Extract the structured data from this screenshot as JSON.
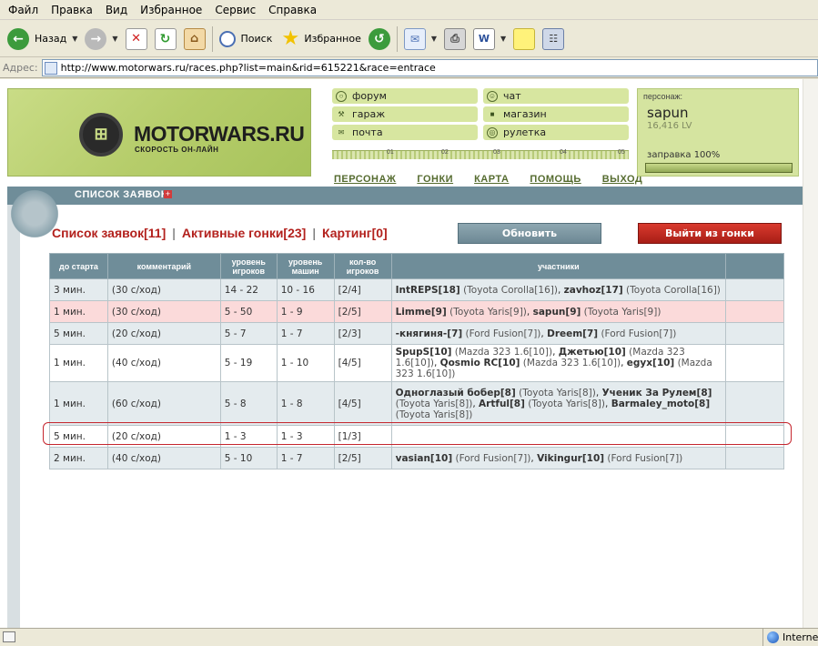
{
  "menu": [
    "Файл",
    "Правка",
    "Вид",
    "Избранное",
    "Сервис",
    "Справка"
  ],
  "toolbar": {
    "back_label": "Назад",
    "search_label": "Поиск",
    "favorites_label": "Избранное"
  },
  "address": {
    "label": "Адрес:",
    "url": "http://www.motorwars.ru/races.php?list=main&rid=615221&race=entrace"
  },
  "logo": {
    "name": "MOTORWARS.RU",
    "tagline": "СКОРОСТЬ ОН-ЛАЙН"
  },
  "nav": {
    "items": [
      {
        "label": "форум",
        "icon": "forum-icon"
      },
      {
        "label": "чат",
        "icon": "chat-icon"
      },
      {
        "label": "гараж",
        "icon": "wrench-icon"
      },
      {
        "label": "магазин",
        "icon": "car-icon"
      },
      {
        "label": "почта",
        "icon": "mail-icon"
      },
      {
        "label": "рулетка",
        "icon": "roulette-icon"
      }
    ],
    "scale": [
      "01",
      "02",
      "03",
      "04",
      "05"
    ],
    "links": [
      "ПЕРСОНАЖ",
      "ГОНКИ",
      "КАРТА",
      "ПОМОЩЬ",
      "ВЫХОД"
    ]
  },
  "player": {
    "header": "персонаж:",
    "name": "sapun",
    "level": "16,416 LV",
    "fuel_label": "заправка 100%",
    "fuel_percent": 100
  },
  "section": {
    "title": "СПИСОК ЗАЯВОК",
    "plus": "+"
  },
  "tabs": [
    {
      "label": "Список заявок[11]"
    },
    {
      "label": "Активные гонки[23]"
    },
    {
      "label": "Картинг[0]"
    }
  ],
  "buttons": {
    "refresh": "Обновить",
    "exit_race": "Выйти из гонки"
  },
  "table": {
    "headers": [
      "до старта",
      "комментарий",
      "уровень игроков",
      "уровень машин",
      "кол-во игроков",
      "участники",
      ""
    ],
    "rows": [
      {
        "start": "3 мин.",
        "comment": "(30 с/ход)",
        "player_level": "14 - 22",
        "car_level": "10 - 16",
        "count": "[2/4]",
        "style": "odd",
        "participants": [
          {
            "name": "IntREPS[18]",
            "car": "(Toyota Corolla[16])"
          },
          {
            "name": "zavhoz[17]",
            "car": "(Toyota Corolla[16])"
          }
        ]
      },
      {
        "start": "1 мин.",
        "comment": "(30 с/ход)",
        "player_level": "5 - 50",
        "car_level": "1 - 9",
        "count": "[2/5]",
        "style": "mine",
        "participants": [
          {
            "name": "Limme[9]",
            "car": "(Toyota Yaris[9])"
          },
          {
            "name": "sapun[9]",
            "car": "(Toyota Yaris[9])"
          }
        ]
      },
      {
        "start": "5 мин.",
        "comment": "(20 с/ход)",
        "player_level": "5 - 7",
        "car_level": "1 - 7",
        "count": "[2/3]",
        "style": "odd",
        "participants": [
          {
            "name": "-княгиня-[7]",
            "car": "(Ford Fusion[7])"
          },
          {
            "name": "Dreem[7]",
            "car": "(Ford Fusion[7])"
          }
        ]
      },
      {
        "start": "1 мин.",
        "comment": "(40 с/ход)",
        "player_level": "5 - 19",
        "car_level": "1 - 10",
        "count": "[4/5]",
        "style": "even",
        "participants": [
          {
            "name": "SpupS[10]",
            "car": "(Mazda 323 1.6[10])"
          },
          {
            "name": "Джетью[10]",
            "car": "(Mazda 323 1.6[10])"
          },
          {
            "name": "Qosmio RC[10]",
            "car": "(Mazda 323 1.6[10])"
          },
          {
            "name": "egyx[10]",
            "car": "(Mazda 323 1.6[10])"
          }
        ]
      },
      {
        "start": "1 мин.",
        "comment": "(60 с/ход)",
        "player_level": "5 - 8",
        "car_level": "1 - 8",
        "count": "[4/5]",
        "style": "odd",
        "participants": [
          {
            "name": "Одноглазый бобер[8]",
            "car": "(Toyota Yaris[8])"
          },
          {
            "name": "Ученик За Рулем[8]",
            "car": "(Toyota Yaris[8])"
          },
          {
            "name": "Artful[8]",
            "car": "(Toyota Yaris[8])"
          },
          {
            "name": "Barmaley_moto[8]",
            "car": "(Toyota Yaris[8])"
          }
        ]
      },
      {
        "start": "5 мин.",
        "comment": "(20 с/ход)",
        "player_level": "1 - 3",
        "car_level": "1 - 3",
        "count": "[1/3]",
        "style": "even",
        "participants": []
      },
      {
        "start": "2 мин.",
        "comment": "(40 с/ход)",
        "player_level": "5 - 10",
        "car_level": "1 - 7",
        "count": "[2/5]",
        "style": "odd",
        "participants": [
          {
            "name": "vasian[10]",
            "car": "(Ford Fusion[7])"
          },
          {
            "name": "Vikingur[10]",
            "car": "(Ford Fusion[7])"
          }
        ]
      }
    ]
  },
  "status": {
    "zone": "Interne"
  },
  "colors": {
    "accent_red": "#b3211d",
    "header_bg": "#6f8d99",
    "green_panel": "#d5e4a0"
  }
}
